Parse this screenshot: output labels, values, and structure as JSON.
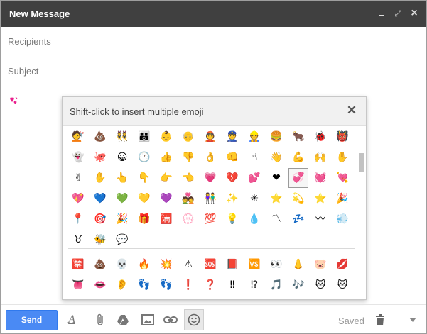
{
  "window": {
    "title": "New Message"
  },
  "compose": {
    "recipients_placeholder": "Recipients",
    "subject_placeholder": "Subject",
    "body_emoji": "💞"
  },
  "picker": {
    "hint": "Shift-click to insert multiple emoji",
    "close_glyph": "✕",
    "selected_emoji": "💞",
    "rows_top": [
      [
        "💇",
        "💩",
        "👯",
        "👪",
        "👶",
        "👴",
        "👲",
        "👮",
        "👷",
        "🍔",
        "🐂",
        "🐞",
        "👹"
      ],
      [
        "👻",
        "🐙",
        "😀",
        "🕐",
        "👍",
        "👎",
        "👌",
        "👊",
        "☝",
        "👋",
        "💪",
        "🙌",
        "✋"
      ],
      [
        "✌",
        "✋",
        "👆",
        "👇",
        "👉",
        "👈",
        "💗",
        "💔",
        "💕",
        "❤",
        "💞",
        "💓",
        "💘"
      ],
      [
        "💖",
        "💙",
        "💚",
        "💛",
        "💜",
        "💑",
        "👫",
        "✨",
        "✳",
        "⭐",
        "💫",
        "⭐",
        "🎉"
      ],
      [
        "📍",
        "🎯",
        "🎉",
        "🎁",
        "🈵",
        "💮",
        "💯",
        "💡",
        "💧",
        "〽",
        "💤",
        "〰",
        "💨"
      ],
      [
        "♉",
        "🐝",
        "💬"
      ]
    ],
    "rows_bottom": [
      [
        "🈲",
        "💩",
        "💀",
        "🔥",
        "💥",
        "⚠",
        "🆘",
        "📕",
        "🆚",
        "👀",
        "👃",
        "🐷",
        "💋"
      ],
      [
        "👅",
        "👄",
        "👂",
        "👣",
        "👣",
        "❗",
        "❓",
        "‼",
        "⁉",
        "🎵",
        "🎶",
        "🐱",
        "🐱"
      ]
    ]
  },
  "toolbar": {
    "send_label": "Send",
    "format_glyph": "A",
    "saved_label": "Saved"
  }
}
